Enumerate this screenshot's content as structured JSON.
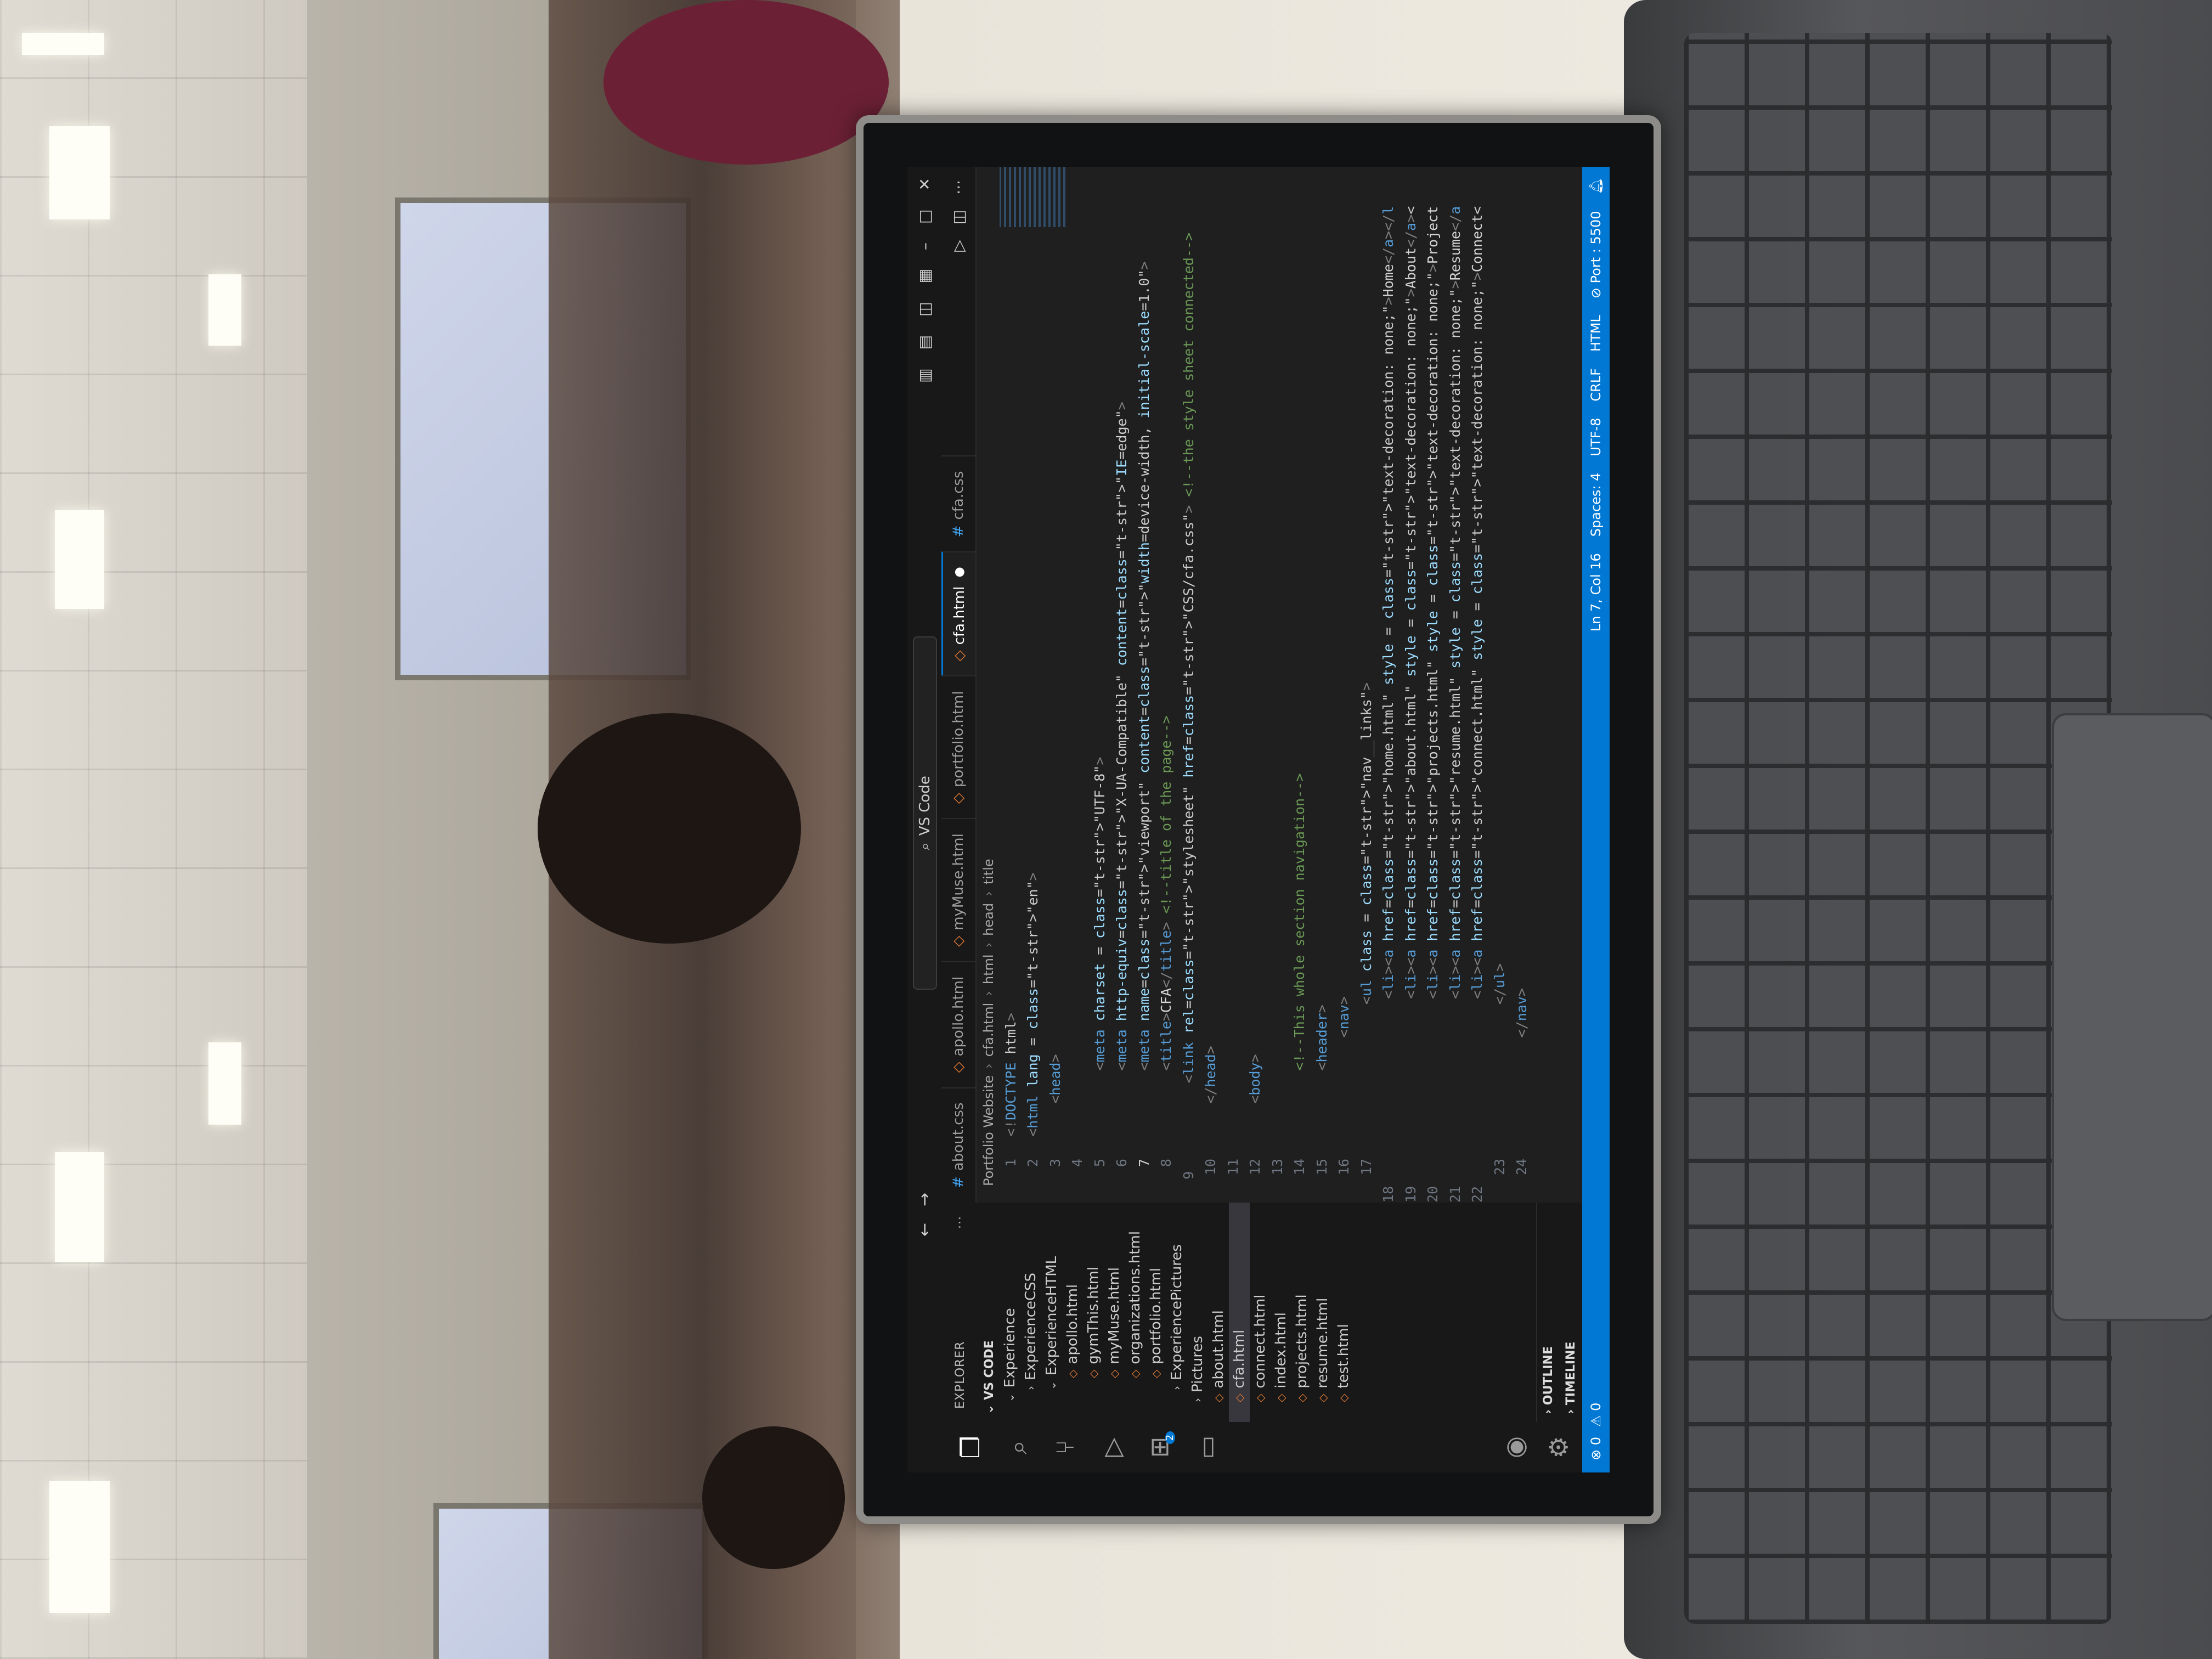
{
  "window": {
    "search_label": "VS Code",
    "nav_back": "←",
    "nav_forward": "→"
  },
  "activity_bar": {
    "icons": [
      "explorer-icon",
      "search-icon",
      "source-control-icon",
      "run-debug-icon",
      "extensions-icon",
      "remote-explorer-icon"
    ],
    "extensions_badge": "2"
  },
  "sidebar": {
    "header": "EXPLORER",
    "more": "···",
    "section": "VS CODE",
    "items": [
      {
        "label": "Experience",
        "kind": "folder-open",
        "indent": 1
      },
      {
        "label": "ExperienceCSS",
        "kind": "folder",
        "indent": 2
      },
      {
        "label": "ExperienceHTML",
        "kind": "folder-open",
        "indent": 2
      },
      {
        "label": "apollo.html",
        "kind": "html",
        "indent": 3
      },
      {
        "label": "gymThis.html",
        "kind": "html",
        "indent": 3
      },
      {
        "label": "myMuse.html",
        "kind": "html",
        "indent": 3
      },
      {
        "label": "organizations.html",
        "kind": "html",
        "indent": 3
      },
      {
        "label": "portfolio.html",
        "kind": "html",
        "indent": 3
      },
      {
        "label": "ExperiencePictures",
        "kind": "folder",
        "indent": 2
      },
      {
        "label": "Pictures",
        "kind": "folder",
        "indent": 1
      },
      {
        "label": "about.html",
        "kind": "html",
        "indent": 1
      },
      {
        "label": "cfa.html",
        "kind": "html",
        "indent": 1,
        "selected": true
      },
      {
        "label": "connect.html",
        "kind": "html",
        "indent": 1
      },
      {
        "label": "index.html",
        "kind": "html",
        "indent": 1
      },
      {
        "label": "projects.html",
        "kind": "html",
        "indent": 1
      },
      {
        "label": "resume.html",
        "kind": "html",
        "indent": 1
      },
      {
        "label": "test.html",
        "kind": "html",
        "indent": 1
      }
    ],
    "outline": "OUTLINE",
    "timeline": "TIMELINE"
  },
  "tabs": [
    {
      "label": "about.css",
      "kind": "css",
      "active": false
    },
    {
      "label": "apollo.html",
      "kind": "html",
      "active": false
    },
    {
      "label": "myMuse.html",
      "kind": "html",
      "active": false
    },
    {
      "label": "portfolio.html",
      "kind": "html",
      "active": false
    },
    {
      "label": "cfa.html",
      "kind": "html",
      "active": true,
      "modified": true
    },
    {
      "label": "cfa.css",
      "kind": "css",
      "active": false
    }
  ],
  "breadcrumb": [
    "Portfolio Website",
    "cfa.html",
    "html",
    "head",
    "title"
  ],
  "code_lines": [
    "<!DOCTYPE html>",
    "<html lang = \"en\">",
    "    <head>",
    "",
    "        <meta charset = \"UTF-8\">",
    "        <meta http-equiv=\"X-UA-Compatible\" content=\"IE=edge\">",
    "        <meta name=\"viewport\" content=\"width=device-width, initial-scale=1.0\">",
    "        <title>CFA</title> <!--title of the page-->",
    "        <link rel=\"stylesheet\" href=\"CSS/cfa.css\"> <!--the style sheet connected-->",
    "    </head>",
    "",
    "    <body>",
    "",
    "        <!--This whole section navigation-->",
    "        <header>",
    "            <nav>",
    "                <ul class = \"nav__links\">",
    "                    <li><a href=\"home.html\" style = \"text-decoration: none;\">Home</a></l",
    "                    <li><a href=\"about.html\" style = \"text-decoration: none;\">About</a><",
    "                    <li><a href=\"projects.html\" style = \"text-decoration: none;\">Project",
    "                    <li><a href=\"resume.html\" style = \"text-decoration: none;\">Resume</a",
    "                    <li><a href=\"connect.html\" style = \"text-decoration: none;\">Connect<",
    "                </ul>",
    "            </nav>"
  ],
  "current_line": 7,
  "status_bar": {
    "errors": "⊗ 0",
    "warnings": "⚠ 0",
    "position": "Ln 7, Col 16",
    "spaces": "Spaces: 4",
    "encoding": "UTF-8",
    "eol": "CRLF",
    "language": "HTML",
    "port": "⊘ Port : 5500"
  },
  "colors": {
    "accent": "#0078d4",
    "editor_bg": "#1f1f1f",
    "sidebar_bg": "#181818"
  }
}
